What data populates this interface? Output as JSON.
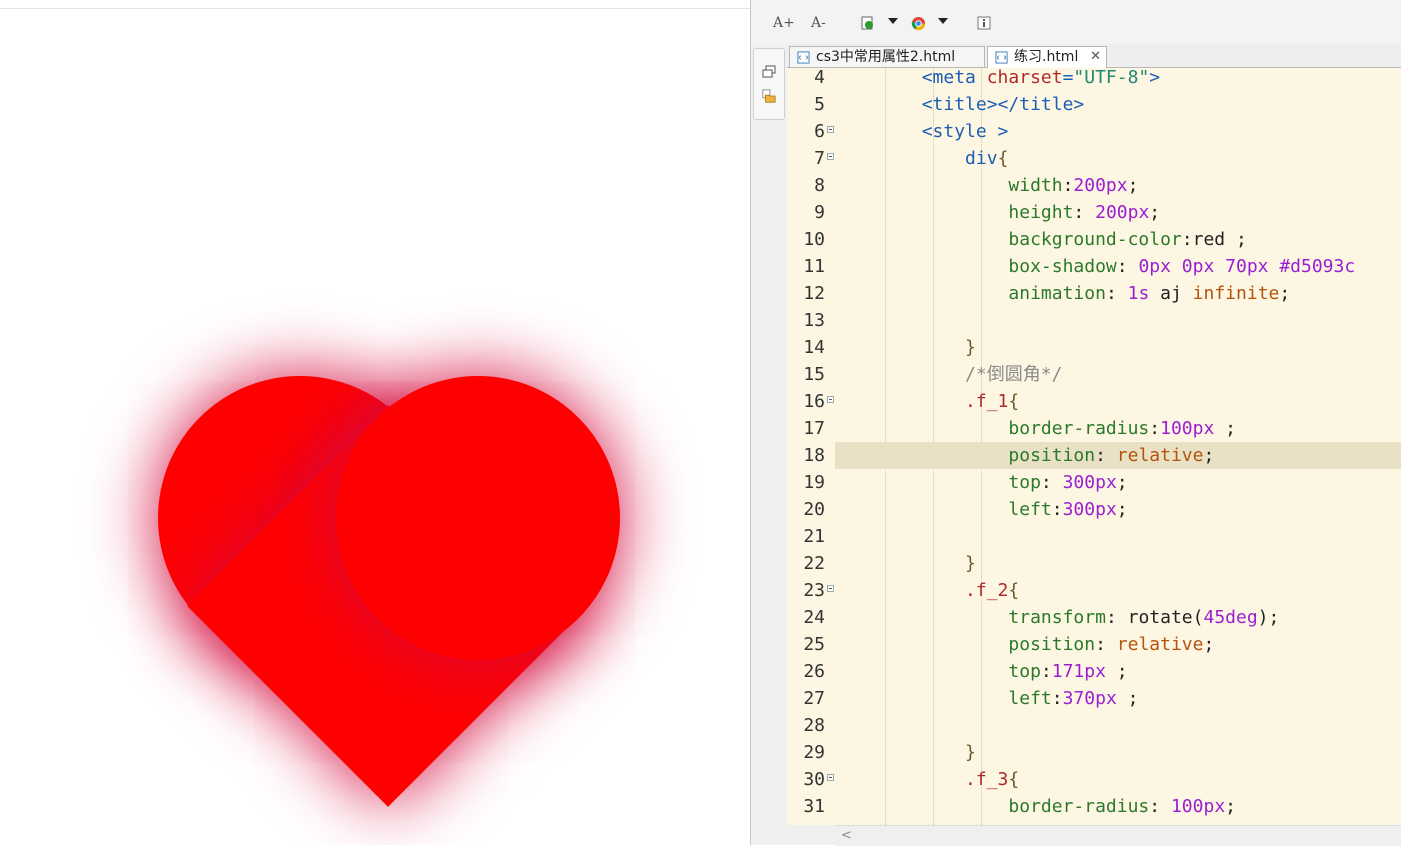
{
  "toolbar": {
    "font_increase_label": "A+",
    "font_decrease_label": "A-"
  },
  "tabs": [
    {
      "label": "cs3中常用属性2.html",
      "active": false
    },
    {
      "label": "练习.html",
      "active": true,
      "close": "✕"
    }
  ],
  "editor": {
    "lines": [
      {
        "n": "4",
        "parts": [
          [
            "t",
            "        <meta "
          ],
          [
            "a",
            "charset"
          ],
          [
            "t",
            "="
          ],
          [
            "s",
            "\"UTF-8\""
          ],
          [
            "t",
            ">"
          ]
        ]
      },
      {
        "n": "5",
        "parts": [
          [
            "t",
            "        <title></title>"
          ]
        ]
      },
      {
        "n": "6",
        "fold": true,
        "parts": [
          [
            "t",
            "        <style >"
          ]
        ]
      },
      {
        "n": "7",
        "fold": true,
        "parts": [
          [
            "g",
            "            div"
          ],
          [
            "b",
            "{"
          ]
        ]
      },
      {
        "n": "8",
        "parts": [
          [
            "p",
            "                width"
          ],
          [
            "x",
            ":"
          ],
          [
            "m",
            "200px"
          ],
          [
            "x",
            ";"
          ]
        ]
      },
      {
        "n": "9",
        "parts": [
          [
            "p",
            "                height"
          ],
          [
            "x",
            ": "
          ],
          [
            "m",
            "200px"
          ],
          [
            "x",
            ";"
          ]
        ]
      },
      {
        "n": "10",
        "parts": [
          [
            "p",
            "                background-color"
          ],
          [
            "x",
            ":red ;"
          ]
        ]
      },
      {
        "n": "11",
        "parts": [
          [
            "p",
            "                box-shadow"
          ],
          [
            "x",
            ": "
          ],
          [
            "m",
            "0px 0px 70px #d5093c"
          ]
        ]
      },
      {
        "n": "12",
        "parts": [
          [
            "p",
            "                animation"
          ],
          [
            "x",
            ": "
          ],
          [
            "m",
            "1s"
          ],
          [
            "x",
            " aj "
          ],
          [
            "k",
            "infinite"
          ],
          [
            "x",
            ";"
          ]
        ]
      },
      {
        "n": "13",
        "parts": [
          [
            "x",
            ""
          ]
        ]
      },
      {
        "n": "14",
        "parts": [
          [
            "b",
            "            }"
          ]
        ]
      },
      {
        "n": "15",
        "parts": [
          [
            "c",
            "            /*倒圆角*/"
          ]
        ]
      },
      {
        "n": "16",
        "fold": true,
        "parts": [
          [
            "r",
            "            .f_1"
          ],
          [
            "b",
            "{"
          ]
        ]
      },
      {
        "n": "17",
        "parts": [
          [
            "p",
            "                border-radius"
          ],
          [
            "x",
            ":"
          ],
          [
            "m",
            "100px"
          ],
          [
            "x",
            " ;"
          ]
        ]
      },
      {
        "n": "18",
        "hl": true,
        "parts": [
          [
            "p",
            "                position"
          ],
          [
            "x",
            ": "
          ],
          [
            "k",
            "relative"
          ],
          [
            "x",
            ";"
          ]
        ]
      },
      {
        "n": "19",
        "parts": [
          [
            "p",
            "                top"
          ],
          [
            "x",
            ": "
          ],
          [
            "m",
            "300px"
          ],
          [
            "x",
            ";"
          ]
        ]
      },
      {
        "n": "20",
        "parts": [
          [
            "p",
            "                left"
          ],
          [
            "x",
            ":"
          ],
          [
            "m",
            "300px"
          ],
          [
            "x",
            ";"
          ]
        ]
      },
      {
        "n": "21",
        "parts": [
          [
            "x",
            ""
          ]
        ]
      },
      {
        "n": "22",
        "parts": [
          [
            "b",
            "            }"
          ]
        ]
      },
      {
        "n": "23",
        "fold": true,
        "parts": [
          [
            "r",
            "            .f_2"
          ],
          [
            "b",
            "{"
          ]
        ]
      },
      {
        "n": "24",
        "parts": [
          [
            "p",
            "                transform"
          ],
          [
            "x",
            ": rotate("
          ],
          [
            "m",
            "45deg"
          ],
          [
            "x",
            ");"
          ]
        ]
      },
      {
        "n": "25",
        "parts": [
          [
            "p",
            "                position"
          ],
          [
            "x",
            ": "
          ],
          [
            "k",
            "relative"
          ],
          [
            "x",
            ";"
          ]
        ]
      },
      {
        "n": "26",
        "parts": [
          [
            "p",
            "                top"
          ],
          [
            "x",
            ":"
          ],
          [
            "m",
            "171px"
          ],
          [
            "x",
            " ;"
          ]
        ]
      },
      {
        "n": "27",
        "parts": [
          [
            "p",
            "                left"
          ],
          [
            "x",
            ":"
          ],
          [
            "m",
            "370px"
          ],
          [
            "x",
            " ;"
          ]
        ]
      },
      {
        "n": "28",
        "parts": [
          [
            "x",
            ""
          ]
        ]
      },
      {
        "n": "29",
        "parts": [
          [
            "b",
            "            }"
          ]
        ]
      },
      {
        "n": "30",
        "fold": true,
        "parts": [
          [
            "r",
            "            .f_3"
          ],
          [
            "b",
            "{"
          ]
        ]
      },
      {
        "n": "31",
        "parts": [
          [
            "p",
            "                border-radius"
          ],
          [
            "x",
            ": "
          ],
          [
            "m",
            "100px"
          ],
          [
            "x",
            ";"
          ]
        ]
      }
    ]
  },
  "scroll": {
    "left_arrow": "<"
  },
  "colors": {
    "heart_red": "#ff0000",
    "shadow": "#d5093c",
    "editor_bg": "#fdf6e3",
    "current_line": "#e8e1c5"
  }
}
